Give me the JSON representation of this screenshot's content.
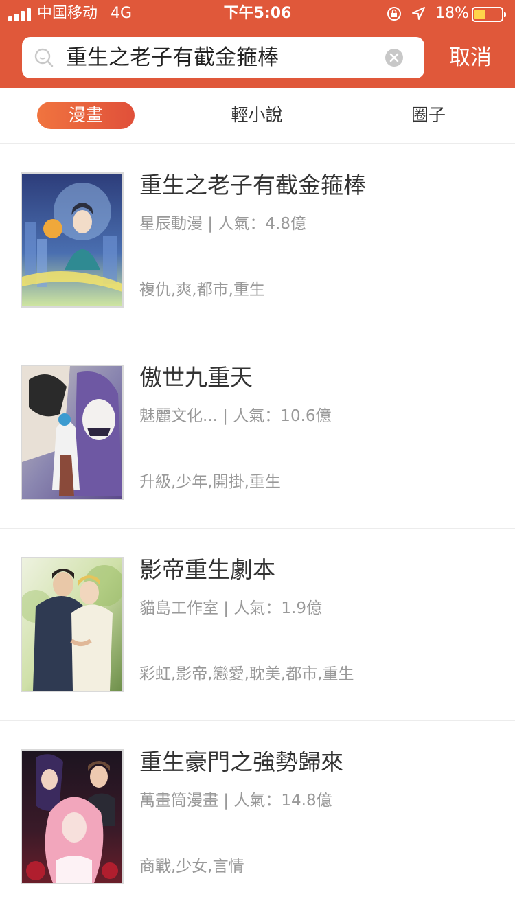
{
  "status_bar": {
    "carrier": "中国移动",
    "network": "4G",
    "time": "下午5:06",
    "battery_percent": "18%",
    "battery_level": 0.18,
    "icons": [
      "signal-icon",
      "orientation-lock-icon",
      "location-arrow-icon",
      "battery-icon"
    ]
  },
  "search": {
    "query": "重生之老子有截金箍棒",
    "cancel_label": "取消",
    "icons": [
      "search-icon",
      "clear-icon"
    ]
  },
  "tabs": [
    {
      "label": "漫畫",
      "active": true
    },
    {
      "label": "輕小說",
      "active": false
    },
    {
      "label": "圈子",
      "active": false
    }
  ],
  "results": [
    {
      "title": "重生之老子有截金箍棒",
      "meta": "星辰動漫 | 人氣：4.8億",
      "tags": "複仇,爽,都市,重生"
    },
    {
      "title": "傲世九重天",
      "meta": "魅麗文化... | 人氣：10.6億",
      "tags": "升級,少年,開掛,重生"
    },
    {
      "title": "影帝重生劇本",
      "meta": "貓島工作室 | 人氣：1.9億",
      "tags": "彩虹,影帝,戀愛,耽美,都市,重生"
    },
    {
      "title": "重生豪門之強勢歸來",
      "meta": "萬畫筒漫畫 | 人氣：14.8億",
      "tags": "商戰,少女,言情"
    }
  ],
  "colors": {
    "brand": "#e0583a",
    "tab_active_start": "#f0743f",
    "tab_active_end": "#e0503a",
    "meta_text": "#999999"
  }
}
